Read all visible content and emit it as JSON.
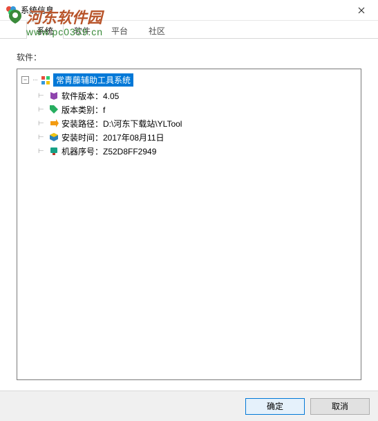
{
  "window": {
    "title": "系统信息"
  },
  "watermark": {
    "brand": "河东软件园",
    "url": "www.pc0359.cn"
  },
  "tabs": [
    "系统",
    "软件",
    "平台",
    "社区"
  ],
  "section": {
    "label": "软件："
  },
  "tree": {
    "root_label": "常青藤辅助工具系统",
    "items": [
      {
        "label": "软件版本：4.05"
      },
      {
        "label": "版本类别：f"
      },
      {
        "label": "安装路径：D:\\河东下载站\\YLTool"
      },
      {
        "label": "安装时间：2017年08月11日"
      },
      {
        "label": "机器序号：Z52D8FF2949"
      }
    ]
  },
  "buttons": {
    "ok": "确定",
    "cancel": "取消"
  }
}
